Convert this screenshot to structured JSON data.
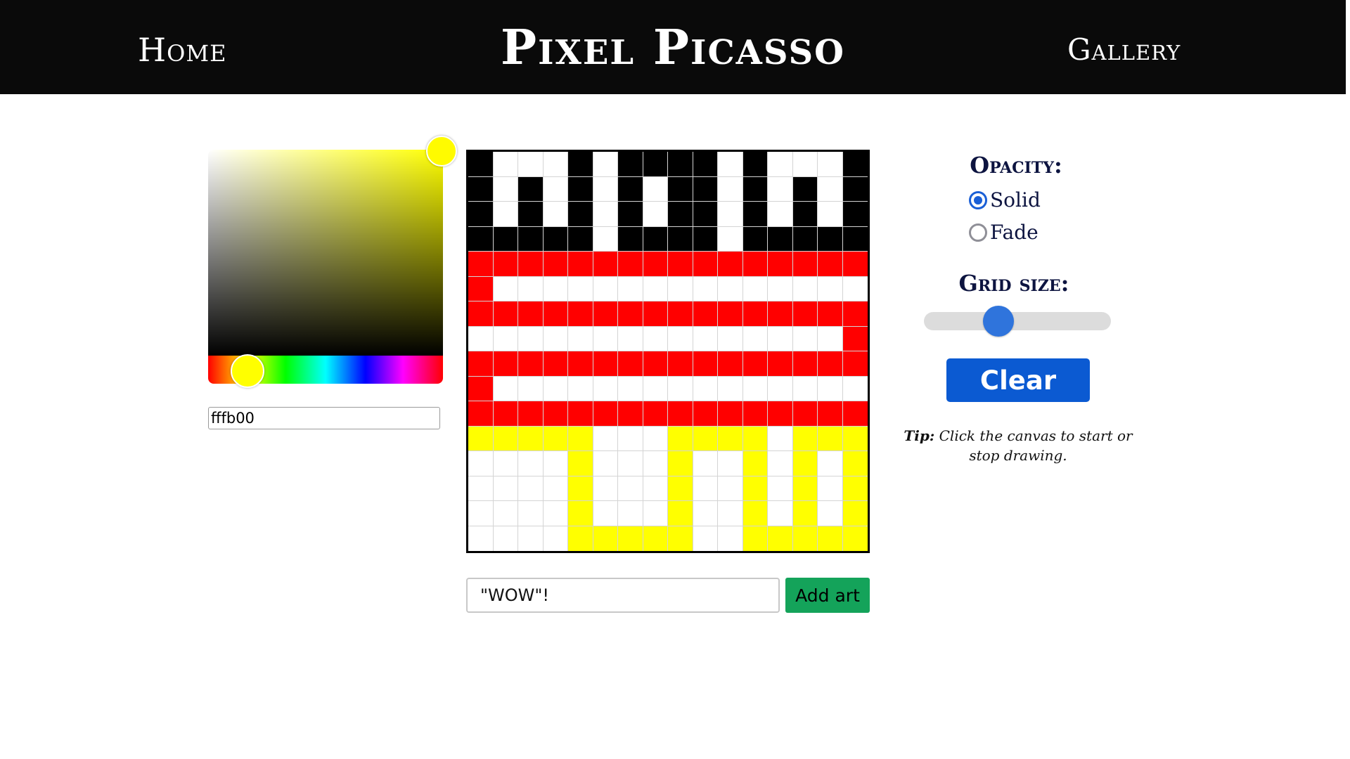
{
  "nav": {
    "home": "Home",
    "title": "Pixel Picasso",
    "gallery": "Gallery"
  },
  "picker": {
    "hue_color": "#ffff00",
    "selected_color": "#fffb00",
    "hex_value": "fffb00"
  },
  "canvas": {
    "grid_size": 16,
    "palette": {
      "W": "#ffffff",
      "K": "#000000",
      "R": "#ff0000",
      "Y": "#ffff00"
    },
    "rows": [
      "KWWWKWKKKKWKWWWK",
      "KWKWKWKWKKWKWKWK",
      "KWKWKWKWKKWKWKWK",
      "KKKKKWKKKKWKKKKK",
      "RRRRRRRRRRRRRRRR",
      "RWWWWWWWWWWWWWWW",
      "RRRRRRRRRRRRRRRR",
      "WWWWWWWWWWWWWWWR",
      "RRRRRRRRRRRRRRRR",
      "RWWWWWWWWWWWWWWW",
      "RRRRRRRRRRRRRRRR",
      "YYYYYWWWYYYYWYYY",
      "WWWWYWWWYWWYWYWY",
      "WWWWYWWWYWWYWYWY",
      "WWWWYWWWYWWYWYWY",
      "WWWWYYYYYWWYYYYY"
    ]
  },
  "art": {
    "title_value": "\"WOW\"!",
    "add_button": "Add art"
  },
  "controls": {
    "opacity_label": "Opacity:",
    "solid_label": "Solid",
    "fade_label": "Fade",
    "selected_opacity": "Solid",
    "grid_size_label": "Grid size:",
    "grid_size_slider_fraction": 0.38,
    "clear_button": "Clear"
  },
  "tip": {
    "label": "Tip:",
    "text": "Click the canvas to start or stop drawing."
  }
}
